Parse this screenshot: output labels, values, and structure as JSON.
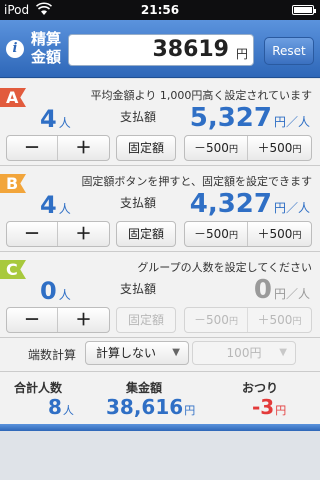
{
  "status_bar": {
    "carrier": "iPod",
    "time": "21:56"
  },
  "header": {
    "label_line1": "精算",
    "label_line2": "金額",
    "amount": "38619",
    "amount_unit": "円",
    "reset_label": "Reset"
  },
  "groups": [
    {
      "tag": "A",
      "hint": "平均金額より 1,000円高く設定されています",
      "count": "4",
      "count_unit": "人",
      "pay_label": "支払額",
      "pay": "5,327",
      "pay_unit": "円／人",
      "minus": "－",
      "plus": "＋",
      "fixed": "固定額",
      "minus500": "－500",
      "plus500": "＋500",
      "yen": "円",
      "enabled": true
    },
    {
      "tag": "B",
      "hint": "固定額ボタンを押すと、固定額を設定できます",
      "count": "4",
      "count_unit": "人",
      "pay_label": "支払額",
      "pay": "4,327",
      "pay_unit": "円／人",
      "minus": "－",
      "plus": "＋",
      "fixed": "固定額",
      "minus500": "－500",
      "plus500": "＋500",
      "yen": "円",
      "enabled": true
    },
    {
      "tag": "C",
      "hint": "グループの人数を設定してください",
      "count": "0",
      "count_unit": "人",
      "pay_label": "支払額",
      "pay": "0",
      "pay_unit": "円／人",
      "minus": "－",
      "plus": "＋",
      "fixed": "固定額",
      "minus500": "－500",
      "plus500": "＋500",
      "yen": "円",
      "enabled": false
    }
  ],
  "rounding": {
    "label": "端数計算",
    "mode": "計算しない",
    "unit": "100円"
  },
  "totals": {
    "people_label": "合計人数",
    "people": "8",
    "people_unit": "人",
    "collected_label": "集金額",
    "collected": "38,616",
    "collected_unit": "円",
    "change_label": "おつり",
    "change": "-3",
    "change_unit": "円"
  },
  "colors": {
    "accent": "#2f6fc5",
    "tag_a": "#e25b3d",
    "tag_b": "#f2a53b",
    "tag_c": "#a8c93d",
    "negative": "#e33a3a"
  }
}
